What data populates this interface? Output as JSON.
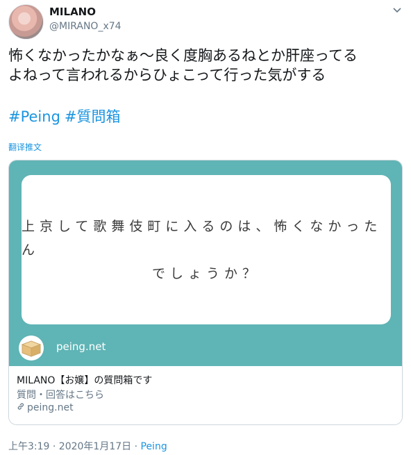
{
  "user": {
    "name": "MILANO",
    "handle": "@MIRANO_x74"
  },
  "tweet": {
    "text_line1": "怖くなかったかなぁ〜良く度胸あるねとか肝座ってる",
    "text_line2": "よねって言われるからひょこって行った気がする",
    "hashtags": [
      "#Peing",
      "#質問箱"
    ],
    "translate_label": "翻译推文"
  },
  "card": {
    "question_line1": "上京して歌舞伎町に入るのは、怖くなかったん",
    "question_line2": "でしょうか？",
    "media_domain": "peing.net",
    "title": "MILANO【お嬢】の質問箱です",
    "description": "質問・回答はこちら",
    "link_domain": "peing.net",
    "media_color": "#5fb4b5"
  },
  "meta": {
    "timestamp": "上午3:19 · 2020年1月17日 · ",
    "source": "Peing"
  },
  "colors": {
    "link": "#1b95e0",
    "secondary": "#657786"
  }
}
